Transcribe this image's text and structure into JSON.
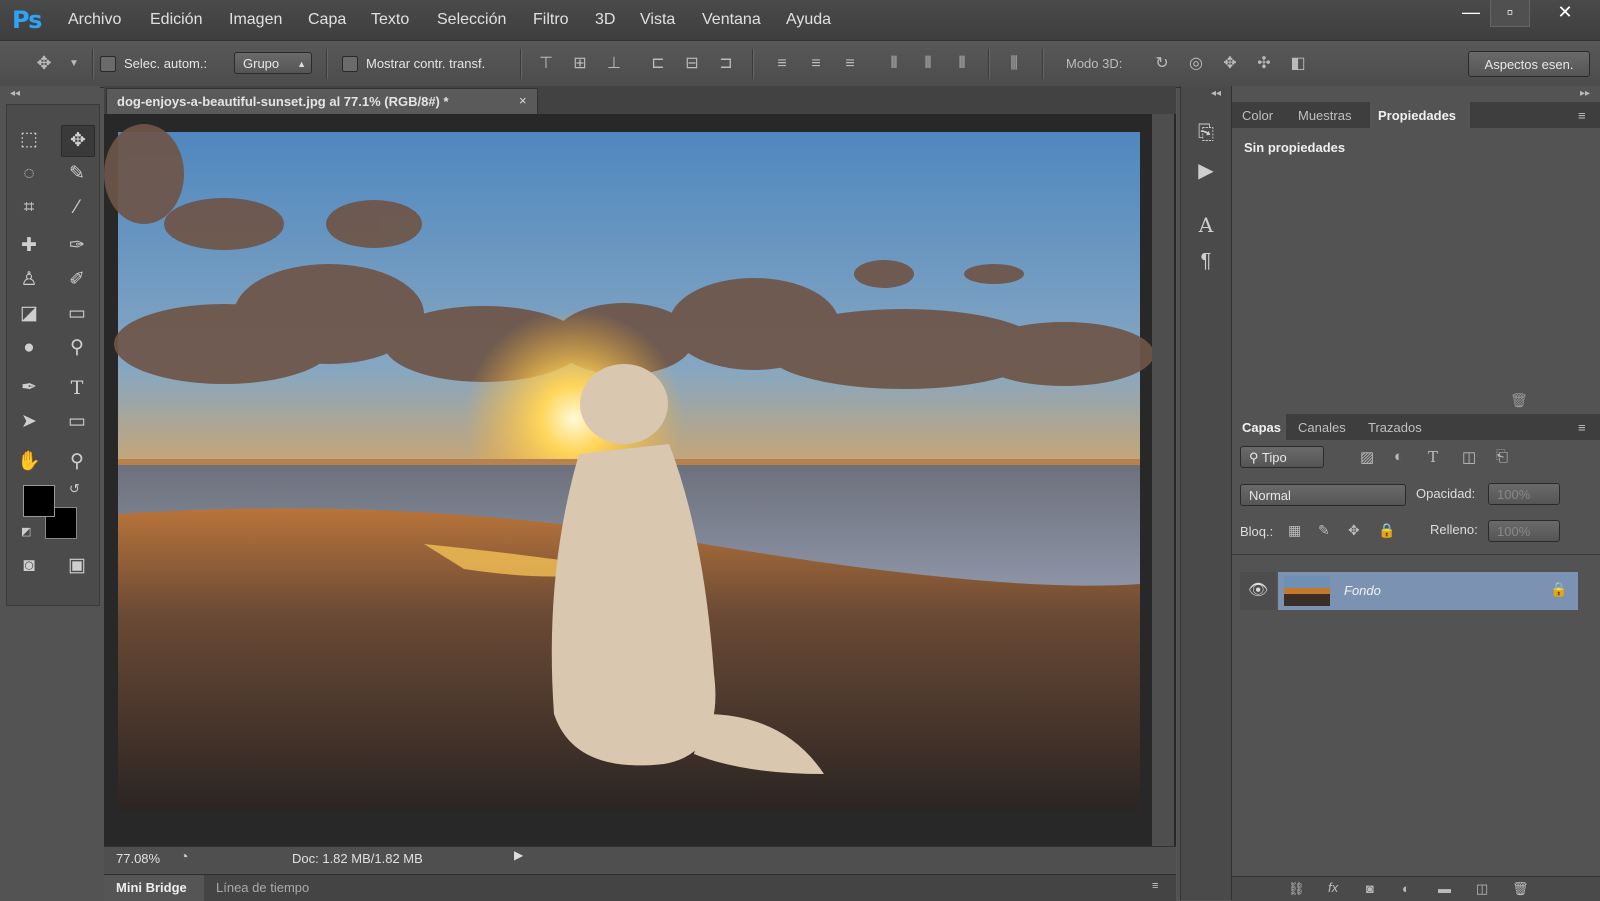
{
  "app": {
    "logo": "Ps"
  },
  "menu": [
    "Archivo",
    "Edición",
    "Imagen",
    "Capa",
    "Texto",
    "Selección",
    "Filtro",
    "3D",
    "Vista",
    "Ventana",
    "Ayuda"
  ],
  "window_controls": {
    "minimize": "—",
    "maximize": "▫",
    "close": "✕"
  },
  "options": {
    "auto_select_label": "Selec. autom.:",
    "auto_select_value": "Grupo",
    "show_transform_label": "Mostrar contr. transf.",
    "mode3d_label": "Modo 3D:",
    "workspace_button": "Aspectos esen."
  },
  "document": {
    "tab_title": "dog-enjoys-a-beautiful-sunset.jpg al 77.1% (RGB/8#) *",
    "close": "×",
    "zoom": "77.08%",
    "doc_size": "Doc: 1.82 MB/1.82 MB"
  },
  "bottom_tabs": [
    "Mini Bridge",
    "Línea de tiempo"
  ],
  "panels": {
    "top_tabs": [
      "Color",
      "Muestras",
      "Propiedades"
    ],
    "top_active": "Propiedades",
    "properties_text": "Sin propiedades",
    "layer_tabs": [
      "Capas",
      "Canales",
      "Trazados"
    ],
    "layer_active": "Capas",
    "filter_label": "Tipo",
    "blend_mode": "Normal",
    "opacity_label": "Opacidad:",
    "opacity_value": "100%",
    "lock_label": "Bloq.:",
    "fill_label": "Relleno:",
    "fill_value": "100%",
    "layer_name": "Fondo"
  },
  "colors": {
    "accent": "#2fa3f5",
    "layer_selected": "#7b92b3"
  }
}
